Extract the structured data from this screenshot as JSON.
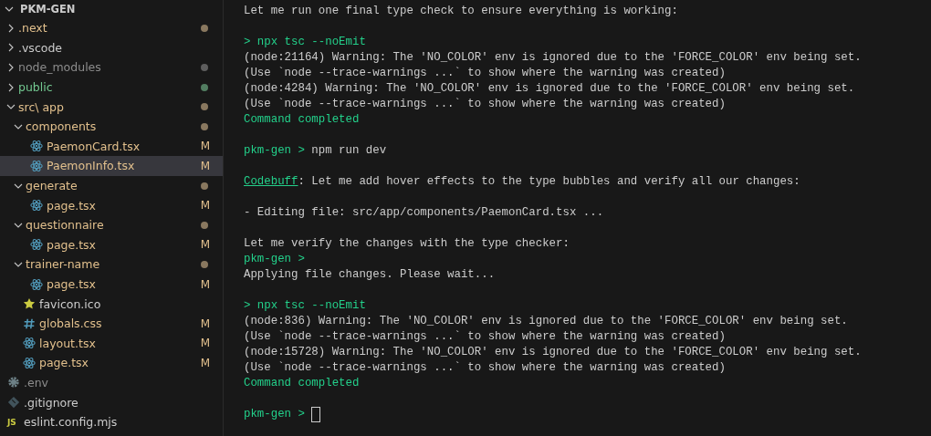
{
  "explorer": {
    "title": "PKM-GEN",
    "expanded": true,
    "items": [
      {
        "name": ".next",
        "kind": "folder",
        "expanded": false,
        "color": "#e2c08d",
        "selected": false
      },
      {
        "name": ".vscode",
        "kind": "folder",
        "expanded": false,
        "color": "#cccccc",
        "selected": false
      },
      {
        "name": "node_modules",
        "kind": "folder",
        "expanded": false,
        "color": "#8c8c8c",
        "selected": false
      },
      {
        "name": "public",
        "kind": "folder",
        "expanded": false,
        "color": "#73c991",
        "selected": false
      },
      {
        "name": "src\\ app",
        "kind": "folder",
        "expanded": true,
        "color": "#e2c08d",
        "selected": false,
        "children": [
          {
            "name": "components",
            "kind": "folder",
            "expanded": true,
            "color": "#e2c08d",
            "selected": false,
            "children": [
              {
                "name": "PaemonCard.tsx",
                "kind": "react",
                "color": "#e2c08d",
                "badge": "M",
                "selected": false
              },
              {
                "name": "PaemonInfo.tsx",
                "kind": "react",
                "color": "#e2c08d",
                "badge": "M",
                "selected": true
              }
            ]
          },
          {
            "name": "generate",
            "kind": "folder",
            "expanded": true,
            "color": "#e2c08d",
            "selected": false,
            "children": [
              {
                "name": "page.tsx",
                "kind": "react",
                "color": "#e2c08d",
                "badge": "M",
                "selected": false
              }
            ]
          },
          {
            "name": "questionnaire",
            "kind": "folder",
            "expanded": true,
            "color": "#e2c08d",
            "selected": false,
            "children": [
              {
                "name": "page.tsx",
                "kind": "react",
                "color": "#e2c08d",
                "badge": "M",
                "selected": false
              }
            ]
          },
          {
            "name": "trainer-name",
            "kind": "folder",
            "expanded": true,
            "color": "#e2c08d",
            "selected": false,
            "children": [
              {
                "name": "page.tsx",
                "kind": "react",
                "color": "#e2c08d",
                "badge": "M",
                "selected": false
              }
            ]
          },
          {
            "name": "favicon.ico",
            "kind": "star",
            "color": "#cccccc",
            "selected": false
          },
          {
            "name": "globals.css",
            "kind": "hash",
            "color": "#e2c08d",
            "badge": "M",
            "selected": false
          },
          {
            "name": "layout.tsx",
            "kind": "react",
            "color": "#e2c08d",
            "badge": "M",
            "selected": false
          },
          {
            "name": "page.tsx",
            "kind": "react",
            "color": "#e2c08d",
            "badge": "M",
            "selected": false
          }
        ]
      },
      {
        "name": ".env",
        "kind": "gear",
        "color": "#8c8c8c",
        "selected": false
      },
      {
        "name": ".gitignore",
        "kind": "diamond",
        "color": "#cccccc",
        "selected": false
      },
      {
        "name": "eslint.config.mjs",
        "kind": "js",
        "icon_text": "JS",
        "color": "#cccccc",
        "selected": false
      }
    ]
  },
  "terminal": {
    "lines": [
      {
        "kind": "text",
        "text": "Let me run one final type check to ensure everything is working:"
      },
      {
        "kind": "blank"
      },
      {
        "kind": "command",
        "text": "> npx tsc --noEmit"
      },
      {
        "kind": "text",
        "text": "(node:21164) Warning: The 'NO_COLOR' env is ignored due to the 'FORCE_COLOR' env being set."
      },
      {
        "kind": "text",
        "text": "(Use `node --trace-warnings ...` to show where the warning was created)"
      },
      {
        "kind": "text",
        "text": "(node:4284) Warning: The 'NO_COLOR' env is ignored due to the 'FORCE_COLOR' env being set."
      },
      {
        "kind": "text",
        "text": "(Use `node --trace-warnings ...` to show where the warning was created)"
      },
      {
        "kind": "success",
        "text": "Command completed"
      },
      {
        "kind": "blank"
      },
      {
        "kind": "prompt",
        "prompt": "pkm-gen >",
        "text": "npm run dev"
      },
      {
        "kind": "blank"
      },
      {
        "kind": "agent",
        "agent": "Codebuff",
        "text": ": Let me add hover effects to the type bubbles and verify all our changes:"
      },
      {
        "kind": "blank"
      },
      {
        "kind": "text",
        "text": "- Editing file: src/app/components/PaemonCard.tsx ..."
      },
      {
        "kind": "blank"
      },
      {
        "kind": "text",
        "text": "Let me verify the changes with the type checker:"
      },
      {
        "kind": "prompt",
        "prompt": "pkm-gen >"
      },
      {
        "kind": "text",
        "text": "Applying file changes. Please wait..."
      },
      {
        "kind": "blank"
      },
      {
        "kind": "command",
        "text": "> npx tsc --noEmit"
      },
      {
        "kind": "text",
        "text": "(node:836) Warning: The 'NO_COLOR' env is ignored due to the 'FORCE_COLOR' env being set."
      },
      {
        "kind": "text",
        "text": "(Use `node --trace-warnings ...` to show where the warning was created)"
      },
      {
        "kind": "text",
        "text": "(node:15728) Warning: The 'NO_COLOR' env is ignored due to the 'FORCE_COLOR' env being set."
      },
      {
        "kind": "text",
        "text": "(Use `node --trace-warnings ...` to show where the warning was created)"
      },
      {
        "kind": "success",
        "text": "Command completed"
      },
      {
        "kind": "blank"
      },
      {
        "kind": "prompt",
        "prompt": "pkm-gen >",
        "cursor": true
      }
    ]
  }
}
